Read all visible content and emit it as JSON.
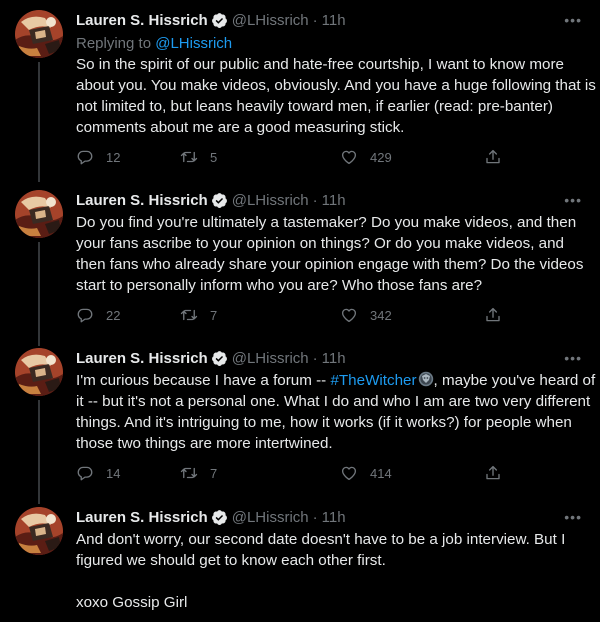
{
  "colors": {
    "background": "#000000",
    "text": "#e7e9ea",
    "muted": "#71767b",
    "accent": "#1d9bf0",
    "thread_line": "#333639"
  },
  "tweets": [
    {
      "author": "Lauren S. Hissrich",
      "handle": "@LHissrich",
      "separator": "·",
      "time": "11h",
      "more": "•••",
      "replying_prefix": "Replying to ",
      "replying_to": "@LHissrich",
      "text": "So in the spirit of our public and hate-free courtship, I want to know more about you. You make videos, obviously. And you have a huge following that is not limited to, but leans heavily toward men, if earlier (read: pre-banter) comments about me are a good measuring stick.",
      "replies": "12",
      "retweets": "5",
      "likes": "429"
    },
    {
      "author": "Lauren S. Hissrich",
      "handle": "@LHissrich",
      "separator": "·",
      "time": "11h",
      "more": "•••",
      "text": "Do you find you're ultimately a tastemaker? Do you make videos, and then your fans ascribe to your opinion on things? Or do you make videos, and then fans who already share your opinion engage with them? Do the videos start to personally inform who you are? Who those fans are?",
      "replies": "22",
      "retweets": "7",
      "likes": "342"
    },
    {
      "author": "Lauren S. Hissrich",
      "handle": "@LHissrich",
      "separator": "·",
      "time": "11h",
      "more": "•••",
      "text_before": "I'm curious because I have a forum -- ",
      "hashtag": "#TheWitcher",
      "text_after": ", maybe you've heard of it -- but it's not a personal one. What I do and who I am are two very different things. And it's intriguing to me, how it works (if it works?) for people when those two things are more intertwined.",
      "replies": "14",
      "retweets": "7",
      "likes": "414"
    },
    {
      "author": "Lauren S. Hissrich",
      "handle": "@LHissrich",
      "separator": "·",
      "time": "11h",
      "more": "•••",
      "text": "And don't worry, our second date doesn't have to be a job interview. But I figured we should get to know each other first.",
      "signoff": "xoxo Gossip Girl"
    }
  ],
  "icons": {
    "verified": "verified-badge-icon",
    "reply": "reply-bubble-icon",
    "retweet": "retweet-arrows-icon",
    "like": "heart-icon",
    "share": "share-upload-icon",
    "hashtag_emoji": "witcher-medallion-emoji"
  }
}
